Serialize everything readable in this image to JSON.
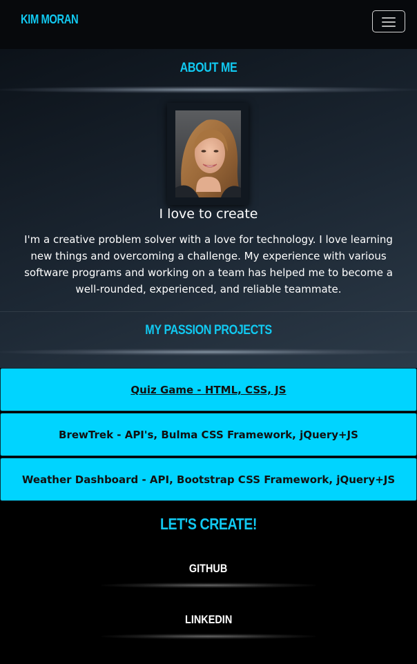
{
  "navbar": {
    "brand": "Kim Moran",
    "menu_icon": "hamburger-menu-icon"
  },
  "about": {
    "heading": "About Me",
    "photo_alt": "Portrait photo",
    "subtitle": "I love to create",
    "bio": "I'm a creative problem solver with a love for technology. I love learning new things and overcoming a challenge. My experience with various software programs and working on a team has helped me to become a well-rounded, experienced, and reliable teammate."
  },
  "projects": {
    "heading": "My Passion Projects",
    "items": [
      {
        "label": "Quiz Game - HTML, CSS, JS"
      },
      {
        "label": "BrewTrek - API's, Bulma CSS Framework, jQuery+JS"
      },
      {
        "label": "Weather Dashboard - API, Bootstrap CSS Framework, jQuery+JS"
      }
    ]
  },
  "contact": {
    "heading": "Let's Create!",
    "links": [
      {
        "label": "GitHub"
      },
      {
        "label": "LinkedIn"
      }
    ]
  },
  "colors": {
    "accent": "#11c9f1",
    "project_button": "#00d4ff",
    "background": "#000000"
  }
}
